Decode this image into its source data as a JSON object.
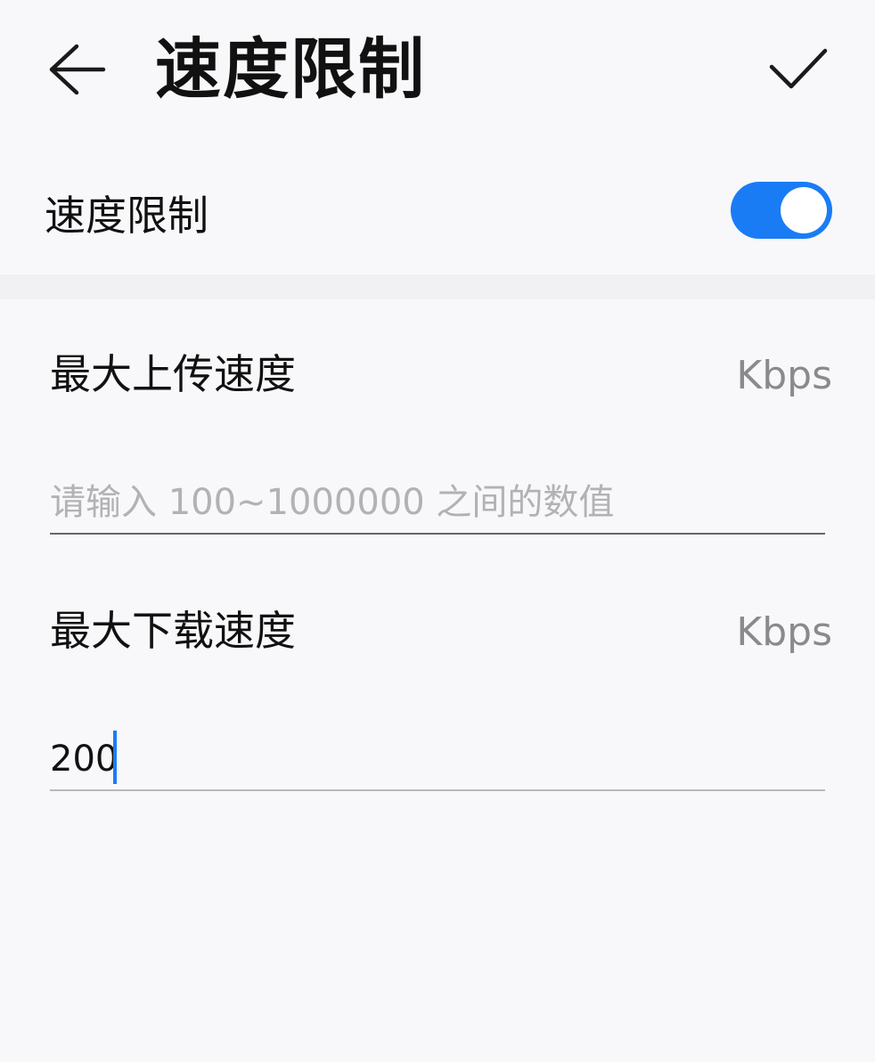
{
  "header": {
    "title": "速度限制",
    "back_icon": "arrow-left-icon",
    "confirm_icon": "check-icon"
  },
  "toggle": {
    "label": "速度限制",
    "enabled": true,
    "accent_color": "#1a7cf5"
  },
  "upload": {
    "label": "最大上传速度",
    "unit": "Kbps",
    "value": "",
    "placeholder": "请输入 100~1000000 之间的数值"
  },
  "download": {
    "label": "最大下载速度",
    "unit": "Kbps",
    "value": "200",
    "placeholder": ""
  }
}
